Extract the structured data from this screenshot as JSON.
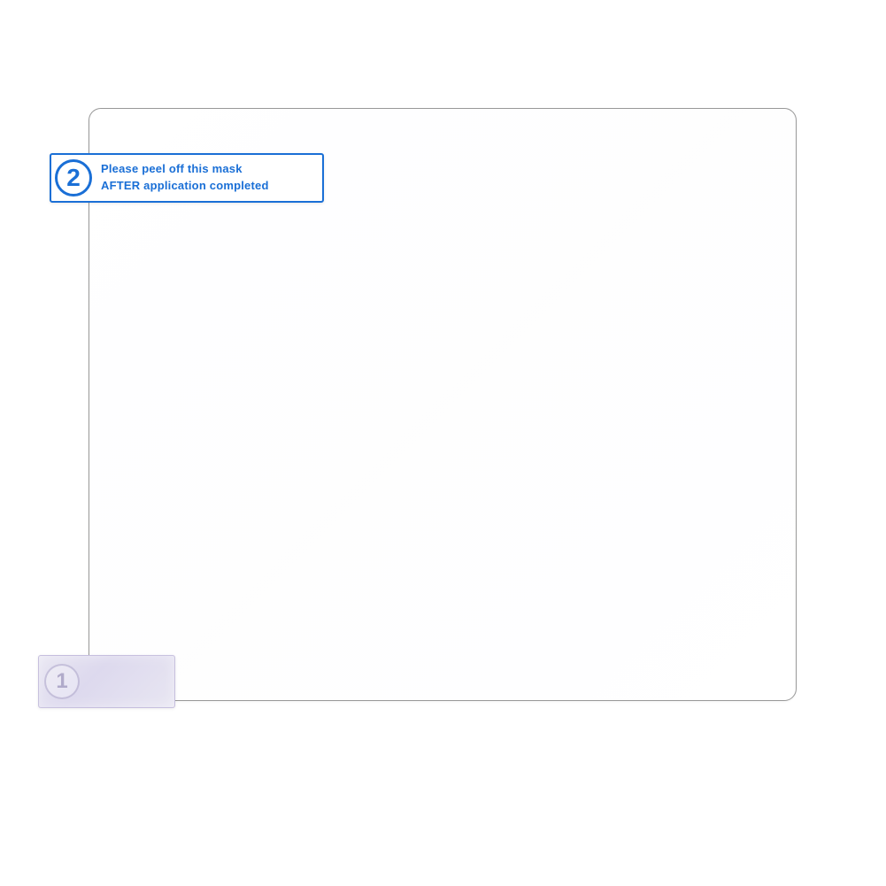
{
  "tab_top": {
    "step_number": "2",
    "line1": "Please peel off this mask",
    "line2": "AFTER application completed"
  },
  "tab_bottom": {
    "step_number": "1"
  }
}
